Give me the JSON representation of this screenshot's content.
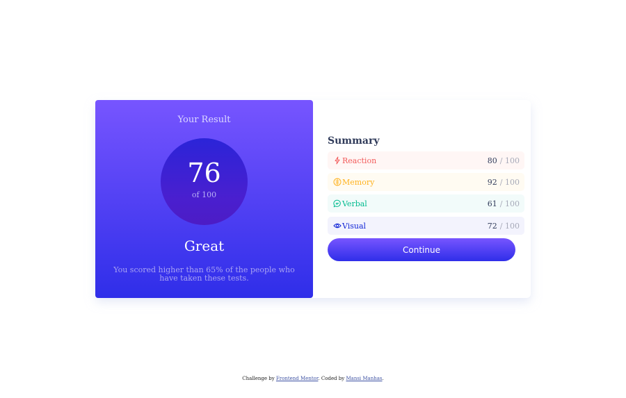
{
  "result": {
    "title": "Your Result",
    "score": "76",
    "score_of": "of 100",
    "rating": "Great",
    "description": "You scored higher than 65% of the people who have taken these tests."
  },
  "summary": {
    "title": "Summary",
    "items": [
      {
        "label": "Reaction",
        "score": "80",
        "max": "/ 100",
        "icon": "lightning-icon",
        "color": "#f25c5c"
      },
      {
        "label": "Memory",
        "score": "92",
        "max": "/ 100",
        "icon": "brain-icon",
        "color": "#ffb21e"
      },
      {
        "label": "Verbal",
        "score": "61",
        "max": "/ 100",
        "icon": "speech-bubble-icon",
        "color": "#00bb8f"
      },
      {
        "label": "Visual",
        "score": "72",
        "max": "/ 100",
        "icon": "eye-icon",
        "color": "#1125d6"
      }
    ],
    "continue_label": "Continue"
  },
  "footer": {
    "prefix": "Challenge by",
    "link1": "Frontend Mentor",
    "middle": ". Coded by",
    "link2": "Mansi Manhas",
    "suffix": "."
  },
  "colors": {
    "gradient_start": "#7755ff",
    "gradient_end": "#2f2ee9",
    "dark_navy": "#303b5a"
  }
}
